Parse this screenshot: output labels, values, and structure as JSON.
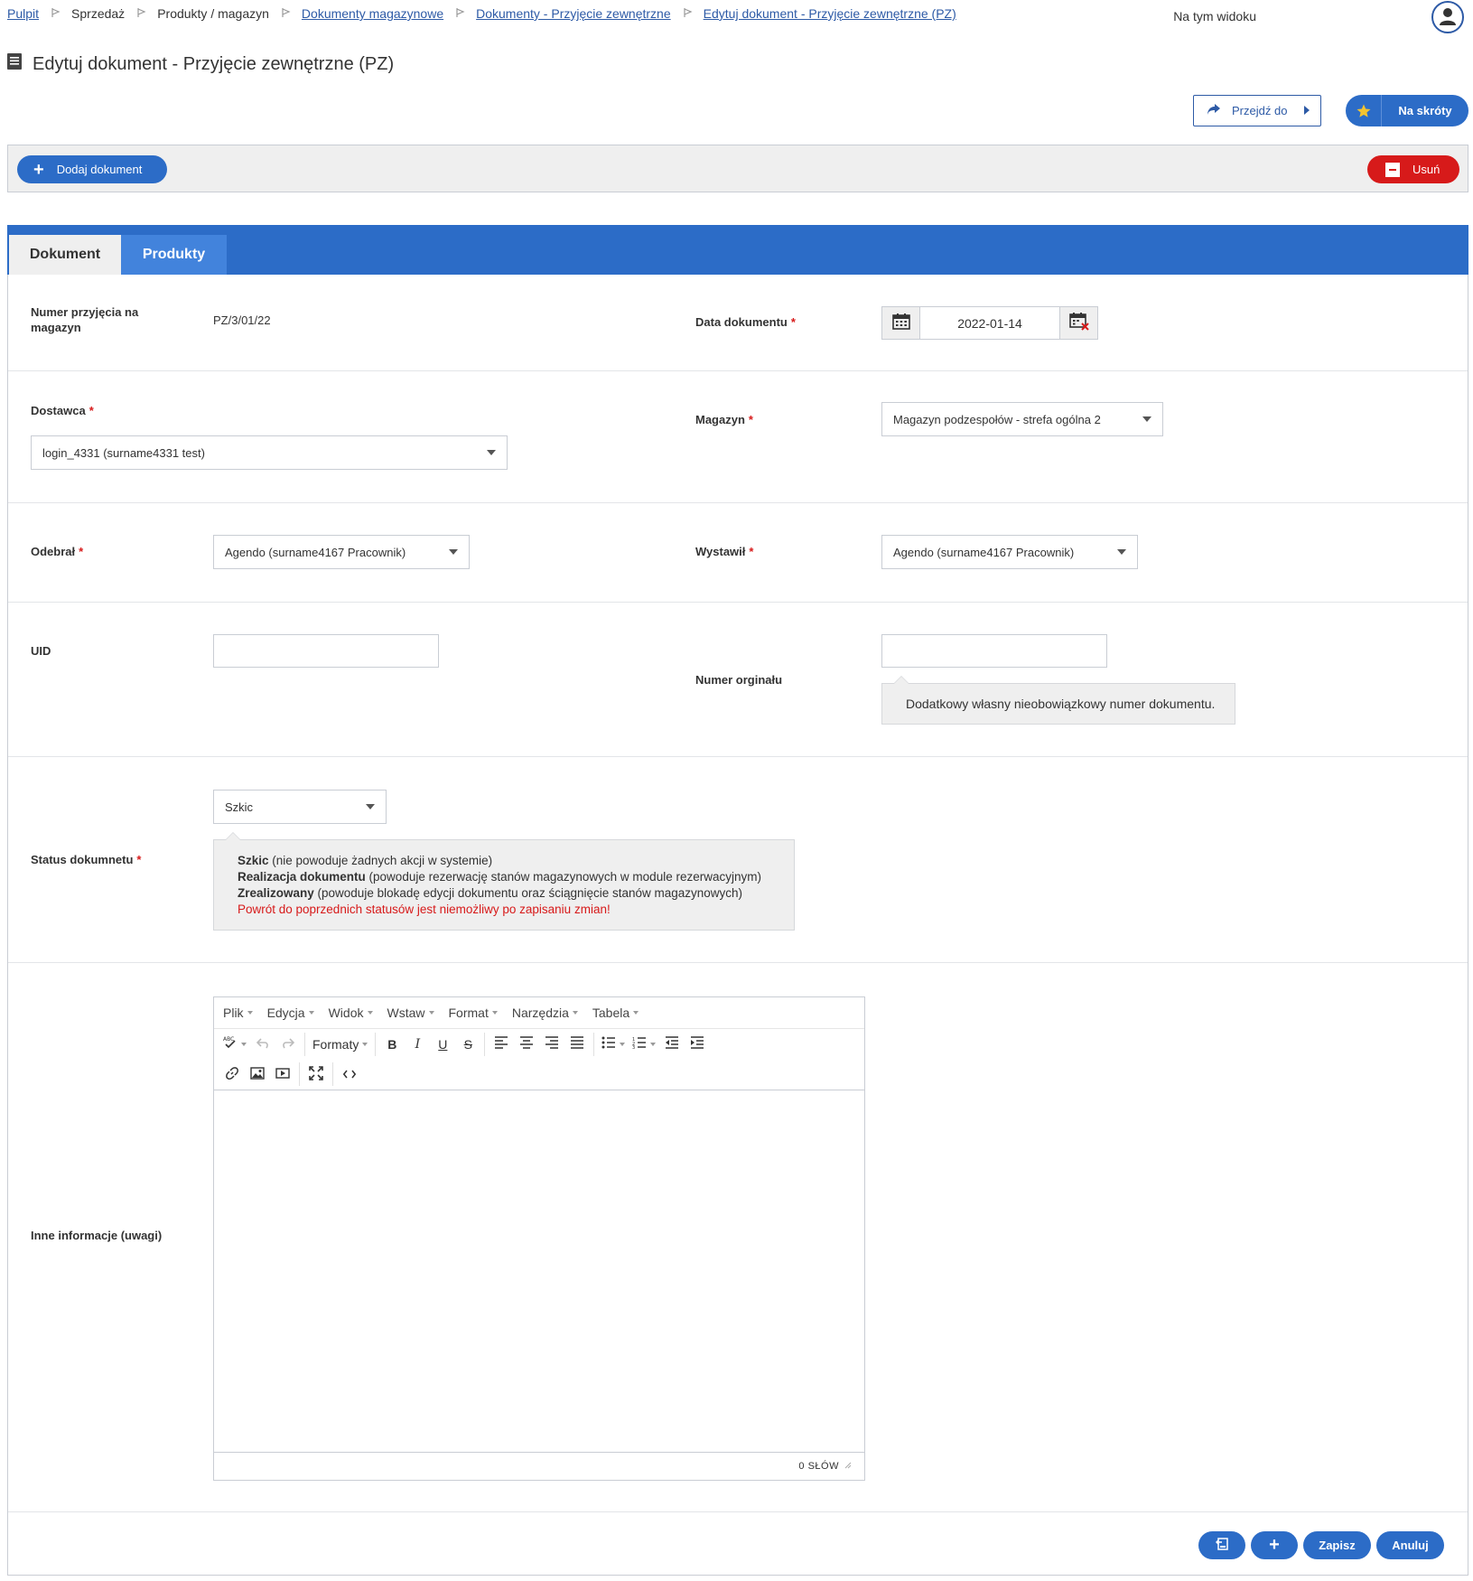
{
  "breadcrumb": [
    {
      "label": "Pulpit",
      "link": true
    },
    {
      "label": "Sprzedaż",
      "link": false
    },
    {
      "label": "Produkty / magazyn",
      "link": false
    },
    {
      "label": "Dokumenty magazynowe",
      "link": true
    },
    {
      "label": "Dokumenty - Przyjęcie zewnętrzne",
      "link": true
    },
    {
      "label": "Edytuj dokument - Przyjęcie zewnętrzne (PZ)",
      "link": true
    }
  ],
  "header": {
    "view_label": "Na tym widoku",
    "page_title": "Edytuj dokument - Przyjęcie zewnętrzne (PZ)",
    "goto_label": "Przejdź do",
    "shortcuts_label": "Na skróty"
  },
  "toolbar": {
    "add_label": "Dodaj dokument",
    "delete_label": "Usuń"
  },
  "tabs": [
    {
      "label": "Dokument",
      "active": true
    },
    {
      "label": "Produkty",
      "active": false
    }
  ],
  "form": {
    "number_label": "Numer przyjęcia na magazyn",
    "number_value": "PZ/3/01/22",
    "date_label": "Data dokumentu",
    "date_value": "2022-01-14",
    "supplier_label": "Dostawca",
    "supplier_value": "login_4331 (surname4331 test)",
    "warehouse_label": "Magazyn",
    "warehouse_value": "Magazyn podzespołów - strefa ogólna 2",
    "received_label": "Odebrał",
    "received_value": "Agendo (surname4167 Pracownik)",
    "issued_label": "Wystawił",
    "issued_value": "Agendo (surname4167 Pracownik)",
    "uid_label": "UID",
    "uid_value": "",
    "orig_label": "Numer orginału",
    "orig_value": "",
    "orig_hint": "Dodatkowy własny nieobowiązkowy numer dokumentu.",
    "status_label": "Status dokumnetu",
    "status_value": "Szkic",
    "status_hint": {
      "l1_bold": "Szkic",
      "l1_rest": " (nie powoduje żadnych akcji w systemie)",
      "l2_bold": "Realizacja dokumentu",
      "l2_rest": " (powoduje rezerwację stanów magazynowych w module rezerwacyjnym)",
      "l3_bold": "Zrealizowany",
      "l3_rest": " (powoduje blokadę edycji dokumentu oraz ściągnięcie stanów magazynowych)",
      "warning": "Powrót do poprzednich statusów jest niemożliwy po zapisaniu zmian!"
    },
    "notes_label": "Inne informacje (uwagi)"
  },
  "editor": {
    "menu": [
      "Plik",
      "Edycja",
      "Widok",
      "Wstaw",
      "Format",
      "Narzędzia",
      "Tabela"
    ],
    "formats_label": "Formaty",
    "word_count": "0 SŁÓW"
  },
  "actions": {
    "save_label": "Zapisz",
    "cancel_label": "Anuluj"
  },
  "colors": {
    "primary": "#2c6cc7",
    "danger": "#d71a1a",
    "link": "#2d5aa6"
  }
}
